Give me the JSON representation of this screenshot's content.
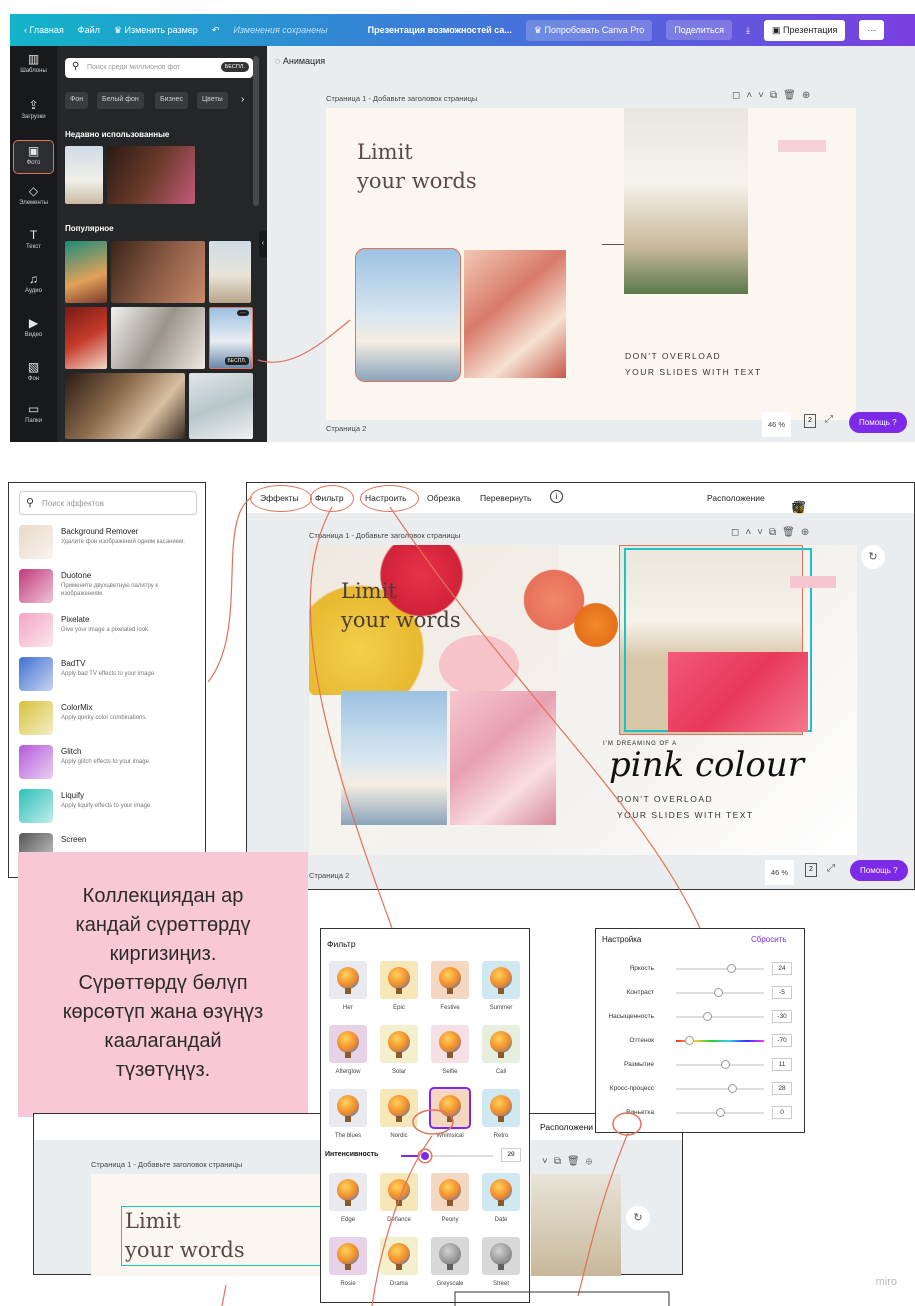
{
  "topbar": {
    "home": "Главная",
    "file": "Файл",
    "resize": "Изменить размер",
    "saved": "Изменения сохранены",
    "title": "Презентация возможностей са...",
    "try_pro": "Попробовать Canva Pro",
    "share": "Поделиться",
    "present": "Презентация",
    "more": "···"
  },
  "sidebar": {
    "items": [
      {
        "label": "Шаблоны",
        "icon": "▥"
      },
      {
        "label": "Загрузки",
        "icon": "⇪"
      },
      {
        "label": "Фото",
        "icon": "▣"
      },
      {
        "label": "Элементы",
        "icon": "◇"
      },
      {
        "label": "Текст",
        "icon": "T"
      },
      {
        "label": "Аудио",
        "icon": "♫"
      },
      {
        "label": "Видео",
        "icon": "▶"
      },
      {
        "label": "Фон",
        "icon": "▧"
      },
      {
        "label": "Папки",
        "icon": "▭"
      }
    ]
  },
  "photos_panel": {
    "search_placeholder": "Поиск среди миллионов фот",
    "free_badge": "БЕСПЛ.",
    "chips": [
      "Фон",
      "Белый фон",
      "Бизнес",
      "Цветы"
    ],
    "recent_title": "Недавно использованные",
    "popular_title": "Популярное",
    "thumb_badge": "БЕСПЛ.",
    "thumb_more": "···"
  },
  "editor1": {
    "animation": "Анимация",
    "page1_label": "Страница 1 - Добавьте заголовок страницы",
    "slide_title_line1": "Limit",
    "slide_title_line2": "your words",
    "tagline_line1": "DON'T OVERLOAD",
    "tagline_line2": "YOUR SLIDES WITH TEXT",
    "page2_label": "Страница 2",
    "zoom": "46 %",
    "page_count": "2",
    "help": "Помощь ?"
  },
  "effects_panel": {
    "search_placeholder": "Поиск эффектов",
    "items": [
      {
        "name": "Background Remover",
        "desc": "Удалите фон изображений одним касанием.",
        "color": "#e8d8c8"
      },
      {
        "name": "Duotone",
        "desc": "Примените двухцветную палитру к изображениям.",
        "color": "#c2387a"
      },
      {
        "name": "Pixelate",
        "desc": "Give your image a pixelated look.",
        "color": "#f3a6c2"
      },
      {
        "name": "BadTV",
        "desc": "Apply bad TV effects to your image.",
        "color": "#3f6fd0"
      },
      {
        "name": "ColorMix",
        "desc": "Apply quirky color combinations.",
        "color": "#d8c23a"
      },
      {
        "name": "Glitch",
        "desc": "Apply glitch effects to your image.",
        "color": "#b45ad8"
      },
      {
        "name": "Liquify",
        "desc": "Apply liquify effects to your image.",
        "color": "#2bc0b8"
      },
      {
        "name": "Screen",
        "desc": "",
        "color": "#555555"
      }
    ]
  },
  "editor2": {
    "toolbar": {
      "effects": "Эффекты",
      "filter": "Фильтр",
      "adjust": "Настроить",
      "crop": "Обрезка",
      "flip": "Перевернуть",
      "info": "i",
      "position": "Расположение"
    },
    "page1_label": "Страница 1 - Добавьте заголовок страницы",
    "slide_title_line1": "Limit",
    "slide_title_line2": "your words",
    "dreaming": "I'M DREAMING OF A",
    "script_title": "pink colour",
    "tagline_line1": "DON'T OVERLOAD",
    "tagline_line2": "YOUR SLIDES WITH TEXT",
    "page2_label": "Страница 2",
    "zoom": "46 %",
    "page_count": "2",
    "help": "Помощь ?"
  },
  "note": {
    "text_lines": [
      "Коллекциядан ар",
      "кандай сүрөттөрдү",
      "киргизиңиз.",
      "Сүрөттөрдү бөлүп",
      "көрсөтүп жана өзүңүз",
      "каалагандай",
      "түзөтүңүз."
    ]
  },
  "filter_panel": {
    "title": "Фильтр",
    "filters_top": [
      "Нет",
      "Epic",
      "Festive",
      "Summer",
      "Afterglow",
      "Solar",
      "Selfie",
      "Cali",
      "The blues",
      "Nordic",
      "Whimsical",
      "Retro"
    ],
    "intensity_label": "Интенсивность",
    "intensity_value": "29",
    "filters_bottom": [
      "Edge",
      "Defiance",
      "Peony",
      "Date",
      "Rosie",
      "Drama",
      "Greyscale",
      "Street"
    ]
  },
  "adjust_panel": {
    "title": "Настройка",
    "reset": "Сбросить",
    "rows": [
      {
        "label": "Яркость",
        "value": "24"
      },
      {
        "label": "Контраст",
        "value": "-5"
      },
      {
        "label": "Насыщенность",
        "value": "-30"
      },
      {
        "label": "Оттенок",
        "value": "-70"
      },
      {
        "label": "Размытие",
        "value": "11"
      },
      {
        "label": "Кросс-процесс",
        "value": "28"
      },
      {
        "label": "Виньетка",
        "value": "0"
      }
    ]
  },
  "editor3": {
    "page1_label": "Страница 1 - Добавьте заголовок страницы",
    "position": "Расположени",
    "slide_title_line1": "Limit",
    "slide_title_line2": "your words"
  },
  "watermark": "miro",
  "colors": {
    "accent_orange": "#e0735a",
    "canva_purple": "#7d2ae8",
    "selection_teal": "#19c3c9"
  }
}
